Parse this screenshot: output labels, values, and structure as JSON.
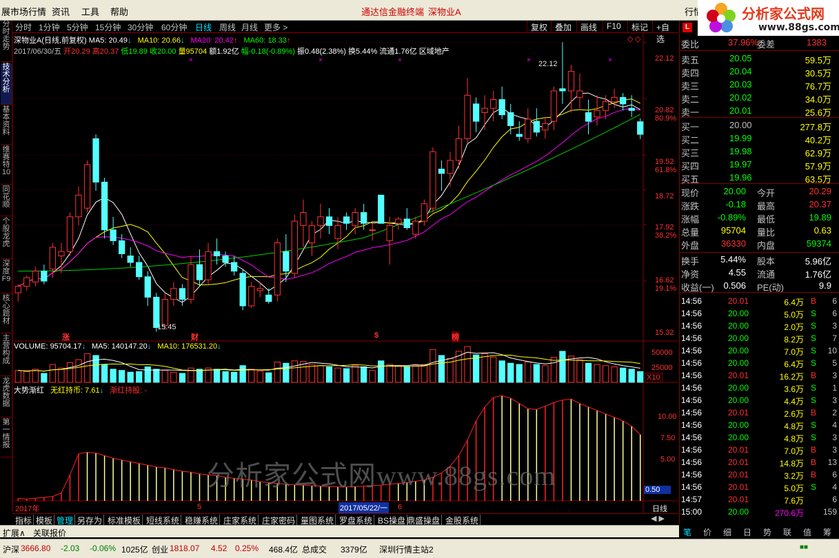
{
  "menu": {
    "items": [
      "展市场行情",
      "资讯",
      "工具",
      "帮助"
    ],
    "center_title": "通达信金融终端",
    "center_stock": "深物业A",
    "right_item": "行情"
  },
  "logo": {
    "text": "分析家公式网",
    "url": "www.88gs.com"
  },
  "left_tabs": [
    "分时走势",
    "技术分析",
    "基本资料",
    "维赛特10",
    "同花顺",
    "个股龙虎",
    "深度F9",
    "核心题材",
    "主营构成",
    "龙虎数据",
    "第一情报"
  ],
  "period_tabs": [
    "分时",
    "1分钟",
    "5分钟",
    "15分钟",
    "30分钟",
    "60分钟",
    "日线",
    "周线",
    "月线",
    "更多 >"
  ],
  "active_period": "日线",
  "toolbar_buttons": [
    "复权",
    "叠加",
    "画线",
    "F10",
    "标记",
    "+自选"
  ],
  "ma_line": {
    "name": "深物业A(日线,前复权)",
    "ma5": "MA5: 20.49",
    "ma10": "MA10: 20.66",
    "ma20": "MA20: 20.42",
    "ma60": "MA60: 18.33"
  },
  "quote_line": {
    "date": "2017/06/30/五",
    "open": "开20.29",
    "high": "高20.37",
    "low": "低19.89",
    "close": "收20.00",
    "vol": "量95704",
    "amount": "额1.92亿",
    "change": "幅-0.18(-0.89%)",
    "amplitude": "振0.48(2.38%)",
    "turnover": "换5.44%",
    "float": "流通1.76亿",
    "sector": "区域地产"
  },
  "price_axis": [
    {
      "label": "22.12",
      "color": "#ff3030"
    },
    {
      "label": "20.82",
      "color": "#ff3030"
    },
    {
      "label": "80.9%",
      "color": "#ff3030"
    },
    {
      "label": "19.52",
      "color": "#ff3030"
    },
    {
      "label": "61.8%",
      "color": "#ff3030"
    },
    {
      "label": "18.72",
      "color": "#ff3030"
    },
    {
      "label": "17.92",
      "color": "#ff3030"
    },
    {
      "label": "38.2%",
      "color": "#ff3030"
    },
    {
      "label": "16.62",
      "color": "#ff3030"
    },
    {
      "label": "19.1%",
      "color": "#ff3030"
    },
    {
      "label": "15.32",
      "color": "#ff3030"
    }
  ],
  "chart_annotations": {
    "high_label": "22.12",
    "low_label": "15.45",
    "markers": [
      "涨",
      "财",
      "$",
      "榜"
    ]
  },
  "volume": {
    "label": "VOLUME: 95704.17",
    "ma5": "MA5: 140147.20",
    "ma10": "MA10: 176531.20",
    "axis": [
      "50000",
      "25000",
      "X10"
    ]
  },
  "indicator": {
    "name": "大势渐红",
    "line1": "无红持币: 7.61",
    "line2": "渐红持股: -",
    "axis": [
      "10.00",
      "7.50",
      "5.00",
      "0.50"
    ]
  },
  "x_axis": {
    "labels": [
      "2017年",
      "5",
      "2017/05/22/一",
      "6"
    ],
    "period_label": "日线"
  },
  "watermark": "分析家公式网www.88gs.com",
  "quote_panel": {
    "weibi": {
      "label": "委比",
      "value": "37.96%",
      "label2": "委差",
      "value2": "1383"
    },
    "asks": [
      {
        "label": "卖五",
        "price": "20.05",
        "vol": "59.5万"
      },
      {
        "label": "卖四",
        "price": "20.04",
        "vol": "30.5万"
      },
      {
        "label": "卖三",
        "price": "20.03",
        "vol": "76.7万"
      },
      {
        "label": "卖二",
        "price": "20.02",
        "vol": "34.0万"
      },
      {
        "label": "卖一",
        "price": "20.01",
        "vol": "25.6万"
      }
    ],
    "bids": [
      {
        "label": "买一",
        "price": "20.00",
        "vol": "277.8万"
      },
      {
        "label": "买二",
        "price": "19.99",
        "vol": "40.2万"
      },
      {
        "label": "买三",
        "price": "19.98",
        "vol": "62.9万"
      },
      {
        "label": "买四",
        "price": "19.97",
        "vol": "57.9万"
      },
      {
        "label": "买五",
        "price": "19.96",
        "vol": "63.5万"
      }
    ],
    "stats": [
      {
        "l1": "现价",
        "v1": "20.00",
        "c1": "#00ff00",
        "l2": "今开",
        "v2": "20.29",
        "c2": "#ff3030"
      },
      {
        "l1": "涨跌",
        "v1": "-0.18",
        "c1": "#00ff00",
        "l2": "最高",
        "v2": "20.37",
        "c2": "#ff3030"
      },
      {
        "l1": "涨幅",
        "v1": "-0.89%",
        "c1": "#00ff00",
        "l2": "最低",
        "v2": "19.89",
        "c2": "#00ff00"
      },
      {
        "l1": "总量",
        "v1": "95704",
        "c1": "#ffff00",
        "l2": "量比",
        "v2": "0.63",
        "c2": "#ffff00"
      },
      {
        "l1": "外盘",
        "v1": "36330",
        "c1": "#ff3030",
        "l2": "内盘",
        "v2": "59374",
        "c2": "#00ff00"
      }
    ],
    "stats2": [
      {
        "l1": "换手",
        "v1": "5.44%",
        "l2": "股本",
        "v2": "5.96亿"
      },
      {
        "l1": "净资",
        "v1": "4.55",
        "l2": "流通",
        "v2": "1.76亿"
      },
      {
        "l1": "收益(一)",
        "v1": "0.506",
        "l2": "PE(动)",
        "v2": "9.9"
      }
    ],
    "ticks": [
      {
        "t": "14:56",
        "p": "20.01",
        "v": "6.4万",
        "bs": "B",
        "n": "6"
      },
      {
        "t": "14:56",
        "p": "20.00",
        "v": "5.0万",
        "bs": "S",
        "n": "6"
      },
      {
        "t": "14:56",
        "p": "20.00",
        "v": "2.0万",
        "bs": "S",
        "n": "3"
      },
      {
        "t": "14:56",
        "p": "20.00",
        "v": "8.2万",
        "bs": "S",
        "n": "7"
      },
      {
        "t": "14:56",
        "p": "20.00",
        "v": "7.0万",
        "bs": "S",
        "n": "10"
      },
      {
        "t": "14:56",
        "p": "20.00",
        "v": "6.4万",
        "bs": "S",
        "n": "5"
      },
      {
        "t": "14:56",
        "p": "20.01",
        "v": "16.2万",
        "bs": "B",
        "n": "3"
      },
      {
        "t": "14:56",
        "p": "20.00",
        "v": "3.6万",
        "bs": "S",
        "n": "1"
      },
      {
        "t": "14:56",
        "p": "20.00",
        "v": "4.4万",
        "bs": "S",
        "n": "3"
      },
      {
        "t": "14:56",
        "p": "20.01",
        "v": "2.6万",
        "bs": "B",
        "n": "2"
      },
      {
        "t": "14:56",
        "p": "20.00",
        "v": "4.8万",
        "bs": "S",
        "n": "4"
      },
      {
        "t": "14:56",
        "p": "20.00",
        "v": "4.8万",
        "bs": "S",
        "n": "3"
      },
      {
        "t": "14:56",
        "p": "20.01",
        "v": "7.0万",
        "bs": "B",
        "n": "3"
      },
      {
        "t": "14:56",
        "p": "20.01",
        "v": "14.8万",
        "bs": "B",
        "n": "13"
      },
      {
        "t": "14:56",
        "p": "20.01",
        "v": "3.2万",
        "bs": "B",
        "n": "6"
      },
      {
        "t": "14:56",
        "p": "20.01",
        "v": "5.0万",
        "bs": "S",
        "n": "4"
      },
      {
        "t": "14:57",
        "p": "20.01",
        "v": "7.6万",
        "bs": "",
        "n": "6"
      },
      {
        "t": "15:00",
        "p": "20.00",
        "v": "270.6万",
        "bs": "",
        "n": "159"
      }
    ]
  },
  "bottom_tabs": [
    "指标",
    "模板",
    "管理",
    "另存为",
    "标准模板",
    "短线系统",
    "稳赚系统",
    "庄家系统",
    "庄家密码",
    "量图系统",
    "罗盘系统",
    "BS操盘",
    "鼎盛操盘",
    "金股系统"
  ],
  "active_bottom_tab": "管理",
  "expand_bar": [
    "扩展∧",
    "关联报价"
  ],
  "right_tabs": [
    "笔",
    "价",
    "细",
    "日",
    "势",
    "联",
    "值",
    "筹"
  ],
  "status": {
    "sh_label": "沪深",
    "sh_value": "3666.80",
    "sh_change": "-2.03",
    "sh_pct": "-0.06%",
    "sh_amount": "1025亿",
    "cy_label": "创业",
    "cy_value": "1818.07",
    "cy_change": "4.52",
    "cy_pct": "0.25%",
    "cy_amount": "468.4亿",
    "total_label": "总成交",
    "total_value": "3379亿",
    "site": "深圳行情主站2"
  },
  "candles": [
    [
      16.35,
      16.55,
      16.15,
      16.5
    ],
    [
      16.5,
      16.75,
      16.4,
      16.7
    ],
    [
      16.6,
      16.95,
      16.5,
      16.85
    ],
    [
      16.85,
      17.0,
      16.55,
      16.62
    ],
    [
      16.9,
      17.5,
      16.7,
      17.4
    ],
    [
      17.2,
      17.5,
      16.8,
      17.3
    ],
    [
      17.3,
      18.2,
      17.2,
      18.1
    ],
    [
      18.1,
      18.8,
      17.9,
      18.6
    ],
    [
      18.3,
      19.4,
      18.2,
      19.3
    ],
    [
      19.9,
      20.0,
      18.7,
      18.9
    ],
    [
      18.9,
      19.0,
      17.6,
      17.8
    ],
    [
      17.8,
      18.1,
      17.45,
      17.55
    ],
    [
      17.55,
      17.7,
      17.15,
      17.25
    ],
    [
      17.2,
      17.4,
      16.95,
      17.05
    ],
    [
      17.05,
      17.2,
      16.65,
      16.72
    ],
    [
      16.72,
      16.85,
      16.05,
      16.25
    ],
    [
      16.25,
      16.35,
      15.45,
      15.55
    ],
    [
      15.6,
      16.35,
      15.5,
      16.2
    ],
    [
      16.2,
      16.6,
      16.05,
      16.45
    ],
    [
      16.45,
      16.55,
      16.05,
      16.2
    ],
    [
      16.2,
      17.2,
      16.1,
      17.0
    ],
    [
      17.0,
      17.35,
      16.5,
      16.65
    ],
    [
      16.65,
      17.5,
      16.55,
      17.3
    ],
    [
      17.3,
      17.6,
      17.0,
      17.2
    ],
    [
      17.2,
      17.3,
      16.95,
      17.05
    ],
    [
      17.05,
      17.2,
      16.75,
      16.85
    ],
    [
      16.8,
      16.9,
      15.95,
      16.05
    ],
    [
      16.05,
      16.6,
      16.0,
      16.5
    ],
    [
      16.4,
      16.6,
      16.25,
      16.45
    ],
    [
      16.3,
      16.45,
      16.1,
      16.15
    ],
    [
      16.3,
      17.6,
      16.15,
      17.5
    ],
    [
      17.3,
      17.7,
      16.6,
      16.85
    ],
    [
      16.8,
      18.15,
      16.7,
      18.0
    ],
    [
      17.9,
      18.5,
      17.4,
      18.2
    ],
    [
      17.5,
      18.0,
      17.2,
      17.9
    ],
    [
      17.9,
      18.4,
      17.6,
      18.1
    ],
    [
      18.1,
      18.3,
      17.7,
      17.9
    ],
    [
      17.6,
      18.1,
      17.35,
      17.9
    ],
    [
      18.1,
      18.2,
      17.8,
      17.95
    ],
    [
      17.9,
      18.3,
      17.7,
      18.2
    ],
    [
      18.2,
      18.4,
      17.8,
      17.95
    ],
    [
      17.8,
      17.95,
      17.55,
      17.8
    ],
    [
      18.6,
      16.6,
      16.6,
      17.95
    ],
    [
      17.55,
      18.1,
      17.0,
      17.9
    ],
    [
      17.95,
      18.1,
      17.8,
      18.05
    ],
    [
      18.05,
      18.3,
      17.8,
      17.85
    ],
    [
      17.7,
      18.1,
      17.6,
      18.0
    ],
    [
      18.0,
      18.5,
      17.9,
      18.4
    ],
    [
      18.3,
      19.7,
      18.2,
      19.6
    ],
    [
      19.2,
      19.4,
      18.7,
      19.1
    ],
    [
      19.1,
      19.6,
      18.8,
      19.4
    ],
    [
      19.4,
      20.2,
      19.2,
      19.9
    ],
    [
      19.9,
      21.3,
      19.8,
      20.9
    ],
    [
      20.7,
      20.85,
      20.05,
      20.3
    ],
    [
      20.5,
      20.9,
      20.1,
      20.6
    ],
    [
      20.6,
      21.0,
      20.3,
      20.8
    ],
    [
      20.8,
      21.1,
      20.35,
      20.45
    ],
    [
      20.5,
      20.7,
      20.0,
      20.2
    ],
    [
      20.0,
      20.3,
      19.85,
      19.95
    ],
    [
      19.9,
      20.6,
      19.8,
      20.35
    ],
    [
      20.3,
      20.6,
      19.95,
      20.05
    ],
    [
      20.1,
      20.4,
      19.9,
      20.25
    ],
    [
      20.3,
      21.1,
      20.1,
      21.0
    ],
    [
      21.05,
      22.12,
      20.7,
      21.0
    ],
    [
      21.0,
      21.6,
      20.5,
      21.45
    ],
    [
      20.85,
      21.4,
      20.6,
      21.0
    ],
    [
      20.5,
      20.8,
      20.0,
      20.3
    ],
    [
      20.4,
      20.9,
      20.2,
      20.55
    ],
    [
      20.55,
      20.9,
      20.35,
      20.75
    ],
    [
      20.75,
      21.05,
      20.6,
      20.85
    ],
    [
      20.85,
      20.95,
      20.55,
      20.7
    ],
    [
      20.6,
      20.9,
      20.4,
      20.55
    ],
    [
      20.29,
      20.37,
      19.89,
      20.0
    ]
  ],
  "volumes": [
    20,
    18,
    22,
    15,
    30,
    24,
    33,
    38,
    48,
    45,
    30,
    22,
    20,
    17,
    18,
    26,
    22,
    20,
    17,
    15,
    24,
    22,
    24,
    22,
    18,
    17,
    28,
    22,
    19,
    16,
    34,
    32,
    36,
    35,
    30,
    28,
    26,
    24,
    23,
    28,
    26,
    20,
    36,
    30,
    28,
    26,
    28,
    30,
    55,
    45,
    40,
    52,
    60,
    46,
    48,
    42,
    36,
    32,
    30,
    34,
    30,
    28,
    42,
    52,
    44,
    38,
    32,
    30,
    28,
    26,
    24,
    22,
    18
  ],
  "indicator_values": [
    0.3,
    0.2,
    0.3,
    0.4,
    0.5,
    0.9,
    3.0,
    5.4,
    5.6,
    5.5,
    5.2,
    4.9,
    4.7,
    4.5,
    4.3,
    4.1,
    3.9,
    3.8,
    3.6,
    3.4,
    3.3,
    3.1,
    3.0,
    2.9,
    2.7,
    2.6,
    2.5,
    2.4,
    2.2,
    2.1,
    2.0,
    1.9,
    1.85,
    1.8,
    1.75,
    1.7,
    1.65,
    1.6,
    1.6,
    1.65,
    1.7,
    1.75,
    1.8,
    1.9,
    2.0,
    2.1,
    2.25,
    2.4,
    2.7,
    3.2,
    4.0,
    5.2,
    7.0,
    9.2,
    10.8,
    11.9,
    12.1,
    11.8,
    11.2,
    10.6,
    10.5,
    10.9,
    11.3,
    11.6,
    11.7,
    11.2,
    10.8,
    10.4,
    10.0,
    9.6,
    9.2,
    8.6,
    7.61
  ],
  "indicator_colors": [
    "r",
    "r",
    "r",
    "r",
    "r",
    "r",
    "r",
    "r",
    "y",
    "y",
    "y",
    "y",
    "y",
    "y",
    "y",
    "y",
    "y",
    "y",
    "y",
    "y",
    "y",
    "y",
    "y",
    "y",
    "y",
    "y",
    "y",
    "y",
    "y",
    "y",
    "y",
    "y",
    "y",
    "y",
    "y",
    "y",
    "y",
    "y",
    "y",
    "y",
    "r",
    "r",
    "r",
    "r",
    "y",
    "y",
    "y",
    "y",
    "r",
    "r",
    "r",
    "r",
    "r",
    "r",
    "r",
    "r",
    "y",
    "y",
    "y",
    "y",
    "y",
    "r",
    "r",
    "r",
    "y",
    "y",
    "y",
    "y",
    "y",
    "y",
    "y",
    "y",
    "y"
  ]
}
